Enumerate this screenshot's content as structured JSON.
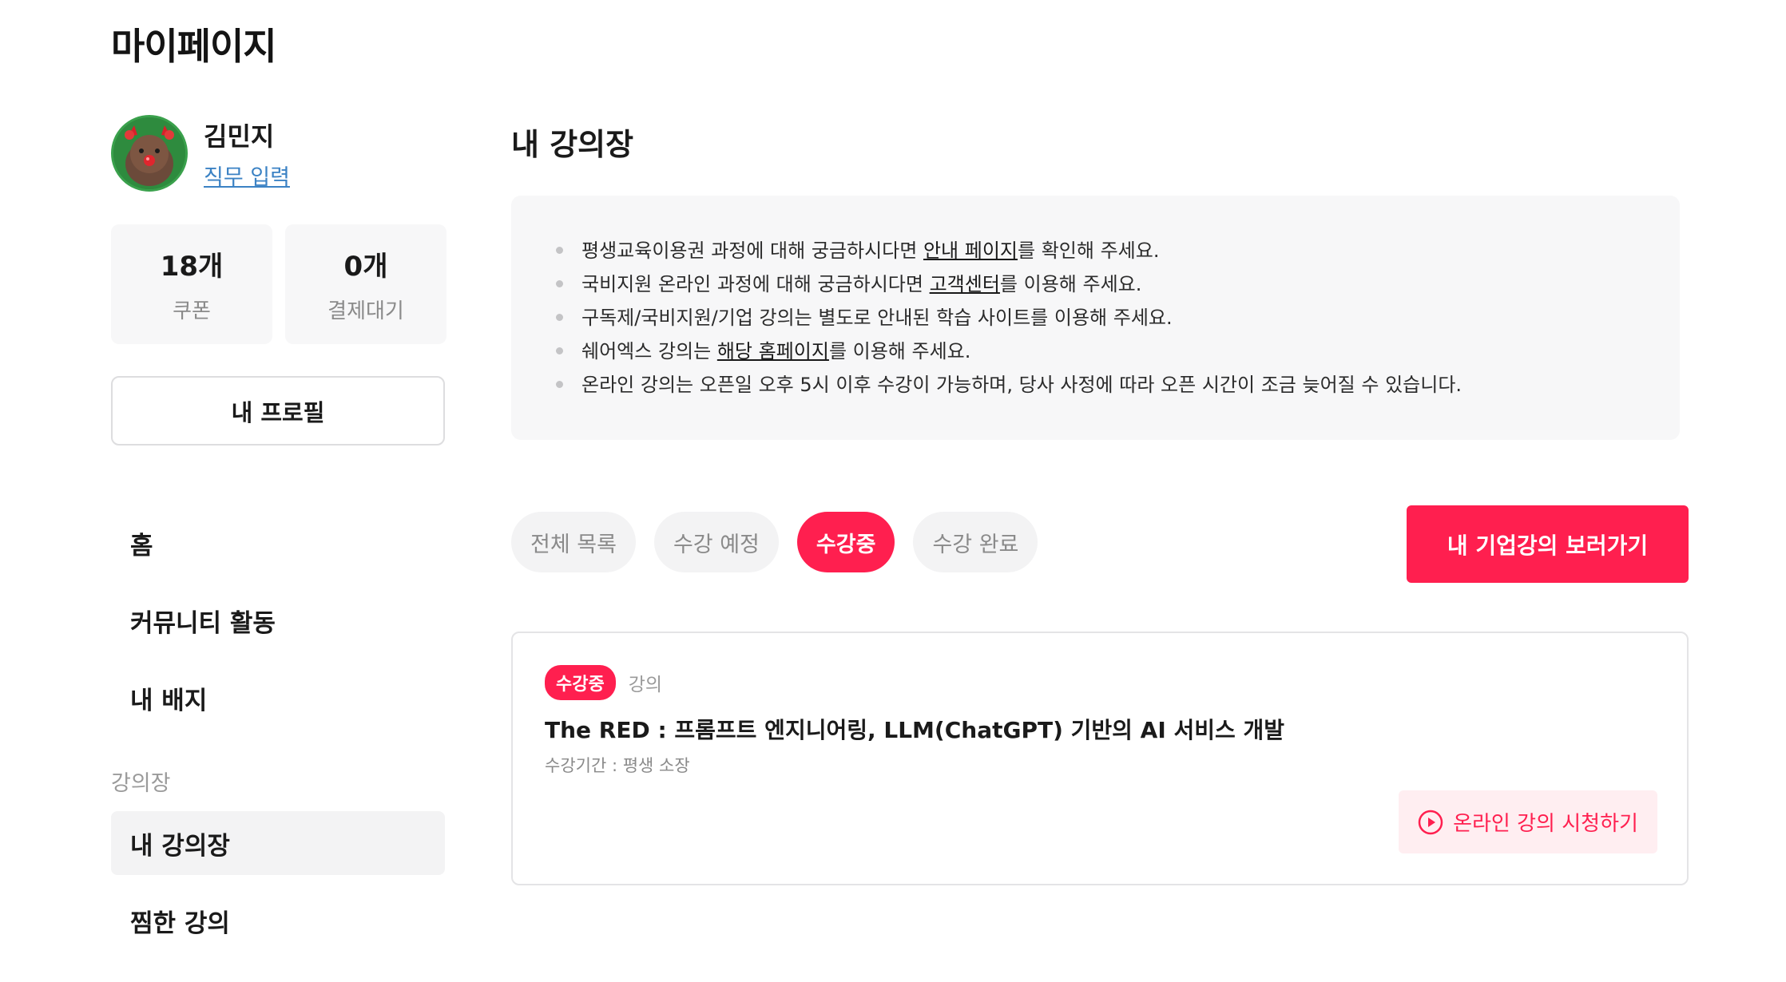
{
  "page": {
    "title": "마이페이지"
  },
  "profile": {
    "name": "김민지",
    "job_link": "직무 입력"
  },
  "stats": [
    {
      "value": "18개",
      "label": "쿠폰"
    },
    {
      "value": "0개",
      "label": "결제대기"
    }
  ],
  "sidebar": {
    "profile_button": "내 프로필",
    "items": [
      {
        "label": "홈"
      },
      {
        "label": "커뮤니티 활동"
      },
      {
        "label": "내 배지"
      }
    ],
    "section_title": "강의장",
    "section_items": [
      {
        "label": "내 강의장",
        "active": true
      },
      {
        "label": "찜한 강의",
        "active": false
      }
    ]
  },
  "main": {
    "title": "내 강의장",
    "notices": [
      {
        "before": "평생교육이용권 과정에 대해 궁금하시다면 ",
        "link": "안내 페이지",
        "after": "를 확인해 주세요."
      },
      {
        "before": "국비지원 온라인 과정에 대해 궁금하시다면 ",
        "link": "고객센터",
        "after": "를 이용해 주세요."
      },
      {
        "before": "구독제/국비지원/기업 강의는 별도로 안내된 학습 사이트를 이용해 주세요.",
        "link": "",
        "after": ""
      },
      {
        "before": "쉐어엑스 강의는 ",
        "link": "해당 홈페이지",
        "after": "를 이용해 주세요."
      },
      {
        "before": "온라인 강의는 오픈일 오후 5시 이후 수강이 가능하며, 당사 사정에 따라 오픈 시간이 조금 늦어질 수 있습니다.",
        "link": "",
        "after": ""
      }
    ],
    "filters": [
      {
        "label": "전체 목록",
        "active": false
      },
      {
        "label": "수강 예정",
        "active": false
      },
      {
        "label": "수강중",
        "active": true
      },
      {
        "label": "수강 완료",
        "active": false
      }
    ],
    "corp_button": "내 기업강의 보러가기",
    "course": {
      "status": "수강중",
      "type": "강의",
      "title": "The RED : 프롬프트 엔지니어링, LLM(ChatGPT) 기반의 AI 서비스 개발",
      "period": "수강기간 : 평생 소장",
      "watch_button": "온라인 강의 시청하기"
    }
  },
  "colors": {
    "accent": "#ff1f4f",
    "link": "#3b82c4",
    "panel": "#f7f7f8"
  }
}
